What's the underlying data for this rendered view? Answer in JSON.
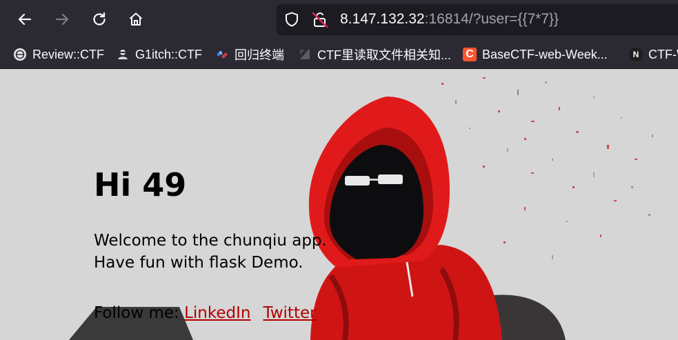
{
  "browser": {
    "url_host": "8.147.132.32",
    "url_rest": ":16814/?user={{7*7}}",
    "nav": [
      {
        "icon": "back-arrow-icon"
      },
      {
        "icon": "forward-arrow-icon",
        "disabled": true
      },
      {
        "icon": "reload-icon"
      },
      {
        "icon": "home-icon"
      }
    ],
    "url_icons": [
      "shield-icon",
      "insecure-lock-icon"
    ],
    "bookmarks": [
      {
        "label": "Review::CTF",
        "icon": "review-ctf-favicon-icon"
      },
      {
        "label": "G1itch::CTF",
        "icon": "g1itch-favicon-icon"
      },
      {
        "label": "回归终端",
        "icon": "terminal-favicon-icon"
      },
      {
        "label": "CTF里读取文件相关知...",
        "icon": "zhihu-favicon-icon"
      },
      {
        "label": "BaseCTF-web-Week...",
        "icon": "csdn-favicon-icon"
      },
      {
        "label": "CTF-W",
        "icon": "notion-favicon-icon"
      }
    ]
  },
  "page": {
    "heading": "Hi 49",
    "intro_line1": "Welcome to the chunqiu app.",
    "intro_line2": "Have fun with flask Demo.",
    "follow_prefix": "Follow me:",
    "links": [
      {
        "label": "LinkedIn"
      },
      {
        "label": "Twitter"
      }
    ],
    "colors": {
      "browser_chrome": "#2b2a33",
      "url_bar": "#1c1b22",
      "link": "#b00000",
      "hoodie": "#e01a1a"
    }
  }
}
